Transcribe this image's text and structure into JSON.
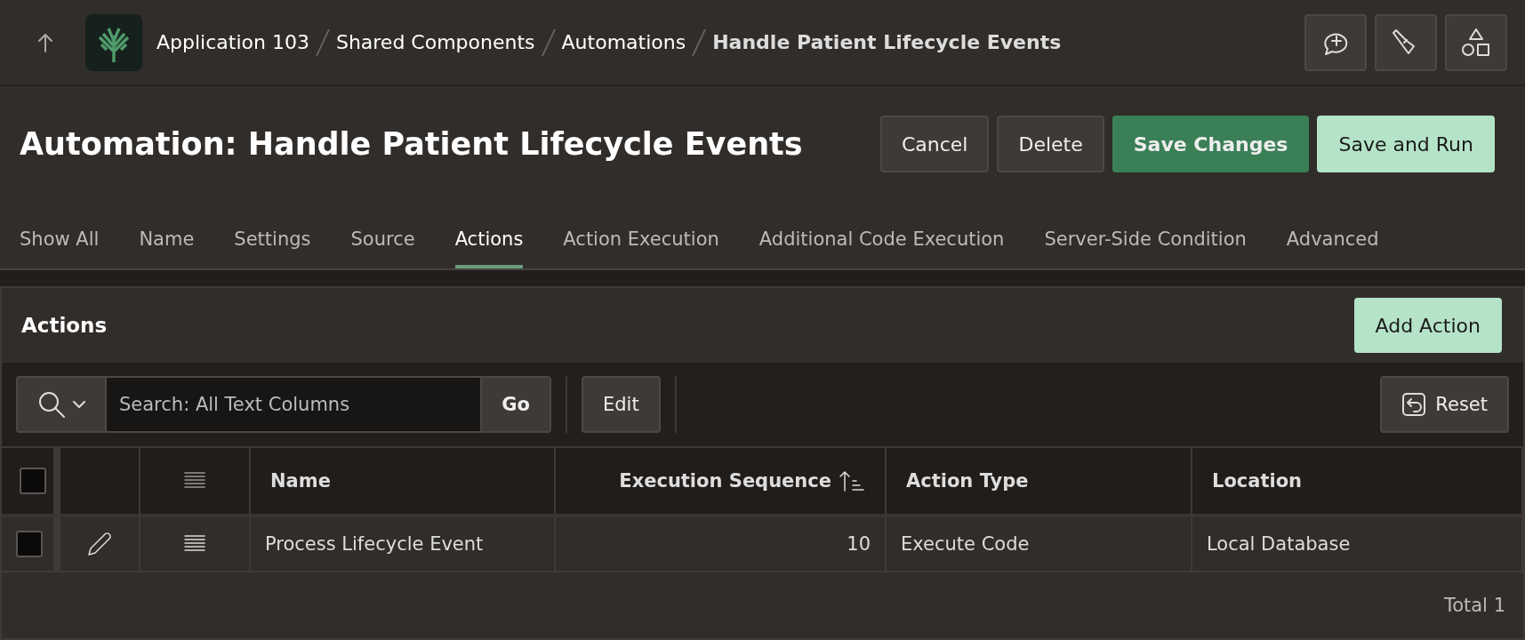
{
  "breadcrumb": [
    {
      "label": "Application 103",
      "current": false
    },
    {
      "label": "Shared Components",
      "current": false
    },
    {
      "label": "Automations",
      "current": false
    },
    {
      "label": "Handle Patient Lifecycle Events",
      "current": true
    }
  ],
  "page_title": "Automation: Handle Patient Lifecycle Events",
  "buttons": [
    {
      "label": "Cancel",
      "kind": "plain"
    },
    {
      "label": "Delete",
      "kind": "plain"
    },
    {
      "label": "Save Changes",
      "kind": "hot"
    },
    {
      "label": "Save and Run",
      "kind": "light"
    }
  ],
  "tabs": [
    {
      "label": "Show All",
      "selected": false
    },
    {
      "label": "Name",
      "selected": false
    },
    {
      "label": "Settings",
      "selected": false
    },
    {
      "label": "Source",
      "selected": false
    },
    {
      "label": "Actions",
      "selected": true
    },
    {
      "label": "Action Execution",
      "selected": false
    },
    {
      "label": "Additional Code Execution",
      "selected": false
    },
    {
      "label": "Server-Side Condition",
      "selected": false
    },
    {
      "label": "Advanced",
      "selected": false
    }
  ],
  "region": {
    "title": "Actions",
    "add_button": "Add Action",
    "search": {
      "placeholder": "Search: All Text Columns",
      "go": "Go"
    },
    "edit_button": "Edit",
    "reset_button": "Reset",
    "select_all_checked": false,
    "columns": [
      {
        "label": "Name",
        "kind": "text",
        "sorted": false
      },
      {
        "label": "Execution Sequence",
        "kind": "number",
        "sorted": true
      },
      {
        "label": "Action Type",
        "kind": "text",
        "sorted": false
      },
      {
        "label": "Location",
        "kind": "text",
        "sorted": false
      }
    ],
    "rows": [
      {
        "checked": false,
        "cells": [
          "Process Lifecycle Event",
          "10",
          "Execute Code",
          "Local Database"
        ]
      }
    ],
    "total": "Total 1"
  }
}
